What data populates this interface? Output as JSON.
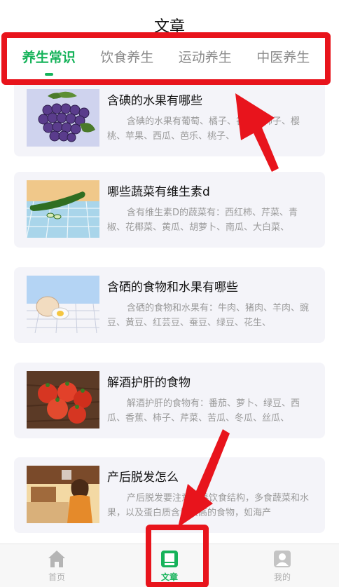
{
  "header": {
    "title": "文章"
  },
  "tabs": [
    {
      "label": "养生常识",
      "active": true
    },
    {
      "label": "饮食养生",
      "active": false
    },
    {
      "label": "运动养生",
      "active": false
    },
    {
      "label": "中医养生",
      "active": false
    }
  ],
  "articles": [
    {
      "title": "含碘的水果有哪些",
      "desc": "含碘的水果有葡萄、橘子、香蕉、柿子、樱桃、苹果、西瓜、芭乐、桃子、",
      "thumb": "grapes"
    },
    {
      "title": "哪些蔬菜有维生素d",
      "desc": "含有维生素D的蔬菜有：西红柿、芹菜、青椒、花椰菜、黄瓜、胡萝卜、南瓜、大白菜、",
      "thumb": "cucumber"
    },
    {
      "title": "含硒的食物和水果有哪些",
      "desc": "含硒的食物和水果有：牛肉、猪肉、羊肉、豌豆、黄豆、红芸豆、蚕豆、绿豆、花生、",
      "thumb": "eggs"
    },
    {
      "title": "解酒护肝的食物",
      "desc": "解酒护肝的食物有：番茄、萝卜、绿豆、西瓜、香蕉、柿子、芹菜、苦瓜、冬瓜、丝瓜、",
      "thumb": "tomatoes"
    },
    {
      "title": "产后脱发怎么",
      "desc": "产后脱发要注意改善饮食结构，多食蔬菜和水果，以及蛋白质含量较高的食物，如海产",
      "thumb": "mother"
    }
  ],
  "nav": [
    {
      "label": "首页",
      "icon": "home-icon",
      "active": false
    },
    {
      "label": "文章",
      "icon": "book-icon",
      "active": true
    },
    {
      "label": "我的",
      "icon": "user-icon",
      "active": false
    }
  ],
  "colors": {
    "accent": "#16b35a",
    "annotation": "#e8141c"
  }
}
